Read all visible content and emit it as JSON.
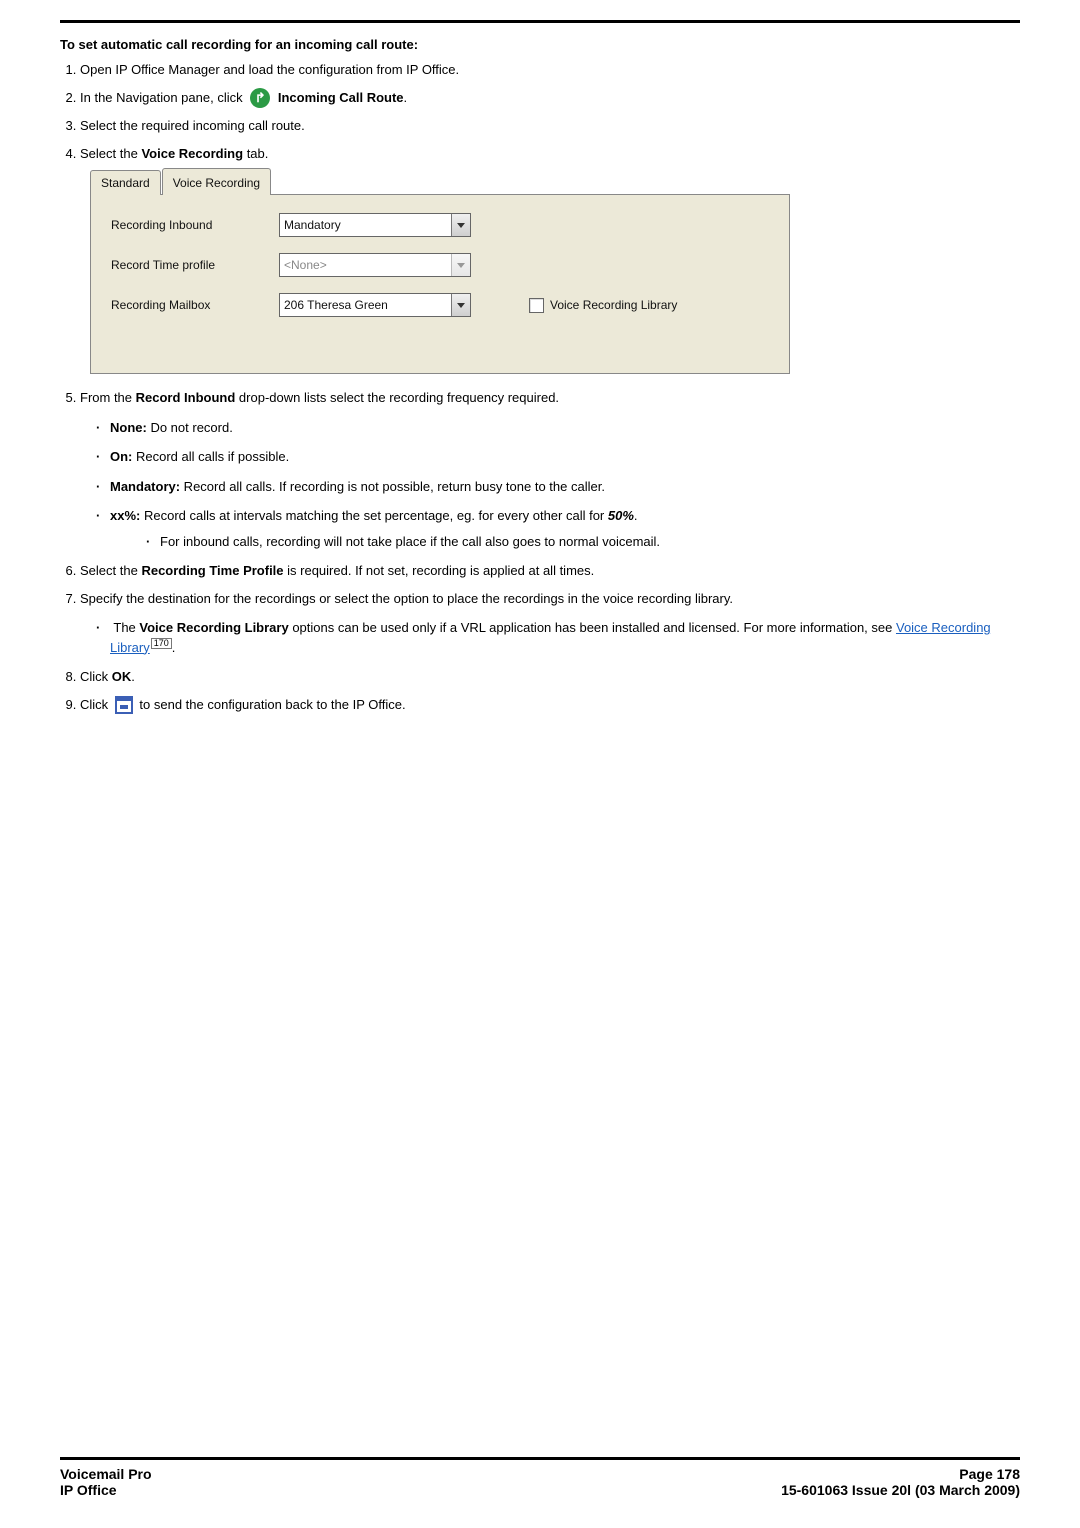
{
  "doc": {
    "heading": "To set automatic call recording for an incoming call route:",
    "steps": {
      "s1": "Open IP Office Manager and load the configuration from IP Office.",
      "s2_pre": "In the Navigation pane, click",
      "s2_icon_glyph": "↱",
      "s2_bold": "Incoming Call Route",
      "s3": "Select the required incoming call route.",
      "s4_pre": "Select the",
      "s4_bold": "Voice Recording",
      "s4_post": " tab.",
      "s5_pre": "From the",
      "s5_bold": "Record Inbound",
      "s5_post": " drop-down lists select the recording frequency required.",
      "s6_pre": "Select the",
      "s6_bold": "Recording Time Profile",
      "s6_post": " is required. If not set, recording is applied at all times.",
      "s7": "Specify the destination for the recordings or select the option to place the recordings in the voice recording library.",
      "s8_pre": "Click ",
      "s8_bold": "OK",
      "s9_pre": "Click",
      "s9_post": " to send the configuration back to the IP Office."
    },
    "bullets5": {
      "none_b": "None:",
      "none_t": " Do not record.",
      "on_b": "On:",
      "on_t": " Record all calls if possible.",
      "mand_b": "Mandatory:",
      "mand_t": " Record all calls. If recording is not possible, return busy tone to the caller.",
      "xx_b": "xx%:",
      "xx_t_pre": " Record calls at intervals matching the set percentage, eg. for every other call for ",
      "xx_t_bi": "50%",
      "sub2": "For inbound calls, recording will not take place if the call also goes to normal voicemail."
    },
    "bullets7": {
      "pre": "The ",
      "bold1": "Voice Recording Library",
      "mid": " options can be used only if a VRL application has been installed and licensed. For more information, see ",
      "linktext": "Voice Recording Library",
      "pageref": "170"
    }
  },
  "panel": {
    "tab_inactive": "Standard",
    "tab_active": "Voice Recording",
    "row1": {
      "label": "Recording Inbound",
      "value": "Mandatory"
    },
    "row2": {
      "label": "Record Time profile",
      "value": "<None>"
    },
    "row3": {
      "label": "Recording Mailbox",
      "value": "206 Theresa Green"
    },
    "checkbox_label": "Voice Recording Library"
  },
  "footer": {
    "left1": "Voicemail Pro",
    "left2": "IP Office",
    "right1": "Page 178",
    "right2": "15-601063 Issue 20l (03 March 2009)"
  },
  "chart_data": null
}
